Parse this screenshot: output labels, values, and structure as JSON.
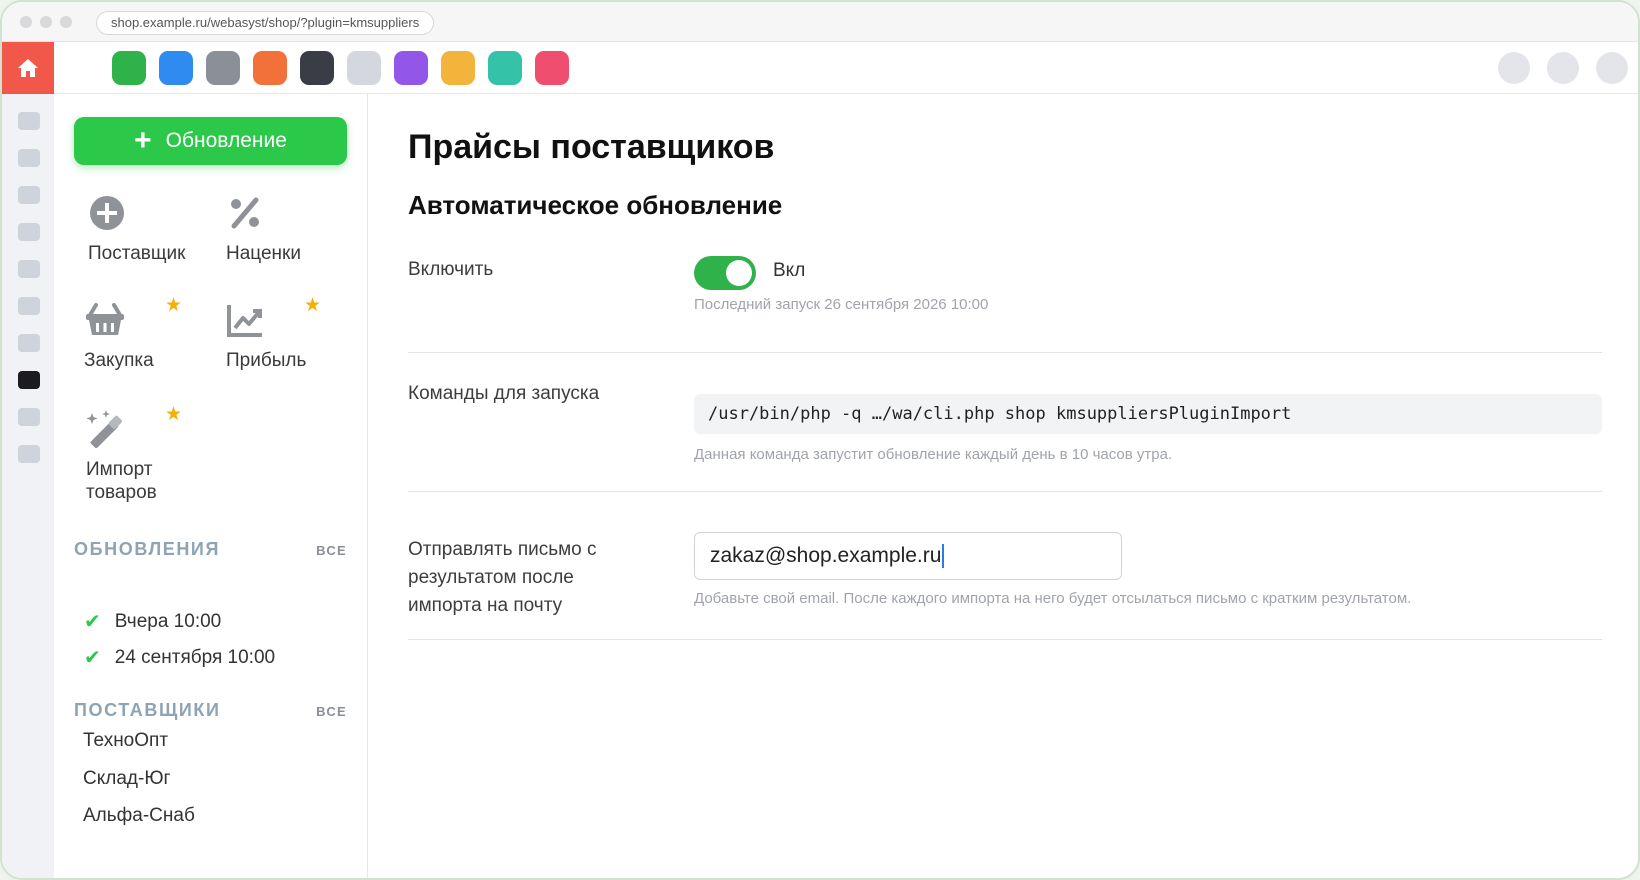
{
  "browser": {
    "url": "shop.example.ru/webasyst/shop/?plugin=kmsuppliers"
  },
  "appbar": {
    "home_icon": "home-icon",
    "apps": [
      {
        "name": "app-green",
        "color": "#2fb24a"
      },
      {
        "name": "app-blue",
        "color": "#2f8bf0"
      },
      {
        "name": "app-gray",
        "color": "#8b9098"
      },
      {
        "name": "app-orange",
        "color": "#f2703a"
      },
      {
        "name": "app-dark",
        "color": "#3a3d45"
      },
      {
        "name": "app-light",
        "color": "#d4d7de"
      },
      {
        "name": "app-purple",
        "color": "#9256e8"
      },
      {
        "name": "app-yellow",
        "color": "#f2b43a"
      },
      {
        "name": "app-teal",
        "color": "#34c3a8"
      },
      {
        "name": "app-pink",
        "color": "#f04e6e"
      }
    ]
  },
  "sidebar": {
    "new_button": {
      "icon": "+",
      "label": "Обновление"
    },
    "tiles": [
      {
        "icon": "plus-circle-icon",
        "label": "Поставщик",
        "star": false
      },
      {
        "icon": "percent-icon",
        "label": "Наценки",
        "star": false
      },
      {
        "icon": "basket-icon",
        "label": "Закупка",
        "star": true
      },
      {
        "icon": "chart-icon",
        "label": "Прибыль",
        "star": true
      },
      {
        "icon": "magic-wand-icon",
        "label_line1": "Импорт",
        "label_line2": "товаров",
        "star": true
      }
    ],
    "updates": {
      "title": "ОБНОВЛЕНИЯ",
      "all": "ВСЕ",
      "items": [
        {
          "label": "Вчера 10:00",
          "status": "ok"
        },
        {
          "label": "24 сентября 10:00",
          "status": "ok"
        }
      ]
    },
    "suppliers": {
      "title": "ПОСТАВЩИКИ",
      "all": "ВСЕ",
      "items": [
        "ТехноОпт",
        "Склад-Юг",
        "Альфа-Снаб"
      ]
    }
  },
  "main": {
    "title": "Прайсы поставщиков",
    "subtitle": "Автоматическое обновление",
    "enable": {
      "label": "Включить",
      "state": "Вкл",
      "on": true,
      "hint": "Последний запуск 26 сентября 2026 10:00"
    },
    "command": {
      "label": "Команды для запуска",
      "value": "/usr/bin/php -q …/wa/cli.php shop kmsuppliersPluginImport",
      "hint": "Данная команда запустит обновление каждый день в 10 часов утра."
    },
    "email": {
      "label_line1": "Отправлять письмо с",
      "label_line2": "результатом после",
      "label_line3": "импорта на почту",
      "value": "zakaz@shop.example.ru",
      "hint": "Добавьте свой email. После каждого импорта на него будет отсылаться письмо с кратким результатом."
    }
  },
  "colors": {
    "accent": "#2bc84a",
    "home": "#f2584a",
    "star": "#f2b10a"
  }
}
